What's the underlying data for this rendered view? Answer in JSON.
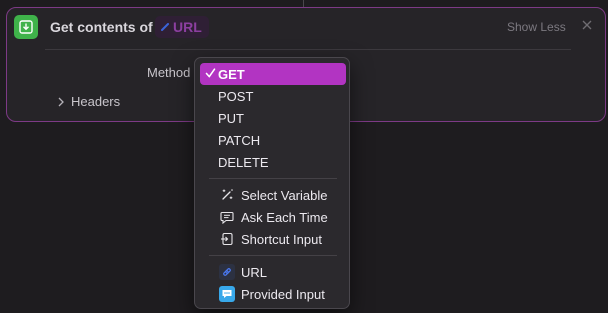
{
  "action": {
    "title": "Get contents of",
    "url_token": "URL",
    "show_less": "Show Less",
    "method_label": "Method",
    "headers_label": "Headers"
  },
  "menu": {
    "methods": [
      "GET",
      "POST",
      "PUT",
      "PATCH",
      "DELETE"
    ],
    "selected": "GET",
    "variables": [
      "Select Variable",
      "Ask Each Time",
      "Shortcut Input"
    ],
    "inputs": [
      "URL",
      "Provided Input"
    ]
  },
  "colors": {
    "accent": "#b234c2",
    "card_border": "#7d3a86",
    "action_icon": "#3fb24a",
    "url_icon": "#3a63d8",
    "provided_input_icon": "#38a8ea"
  },
  "icons": {
    "action": "download-tray-icon",
    "url_token": "link-icon",
    "close": "close-icon",
    "headers": "chevron-right-icon",
    "selected": "checkmark-icon",
    "select_variable": "magic-wand-icon",
    "ask_each_time": "speech-bubble-icon",
    "shortcut_input": "shortcut-input-icon",
    "url": "link-icon",
    "provided_input": "provided-input-icon"
  }
}
